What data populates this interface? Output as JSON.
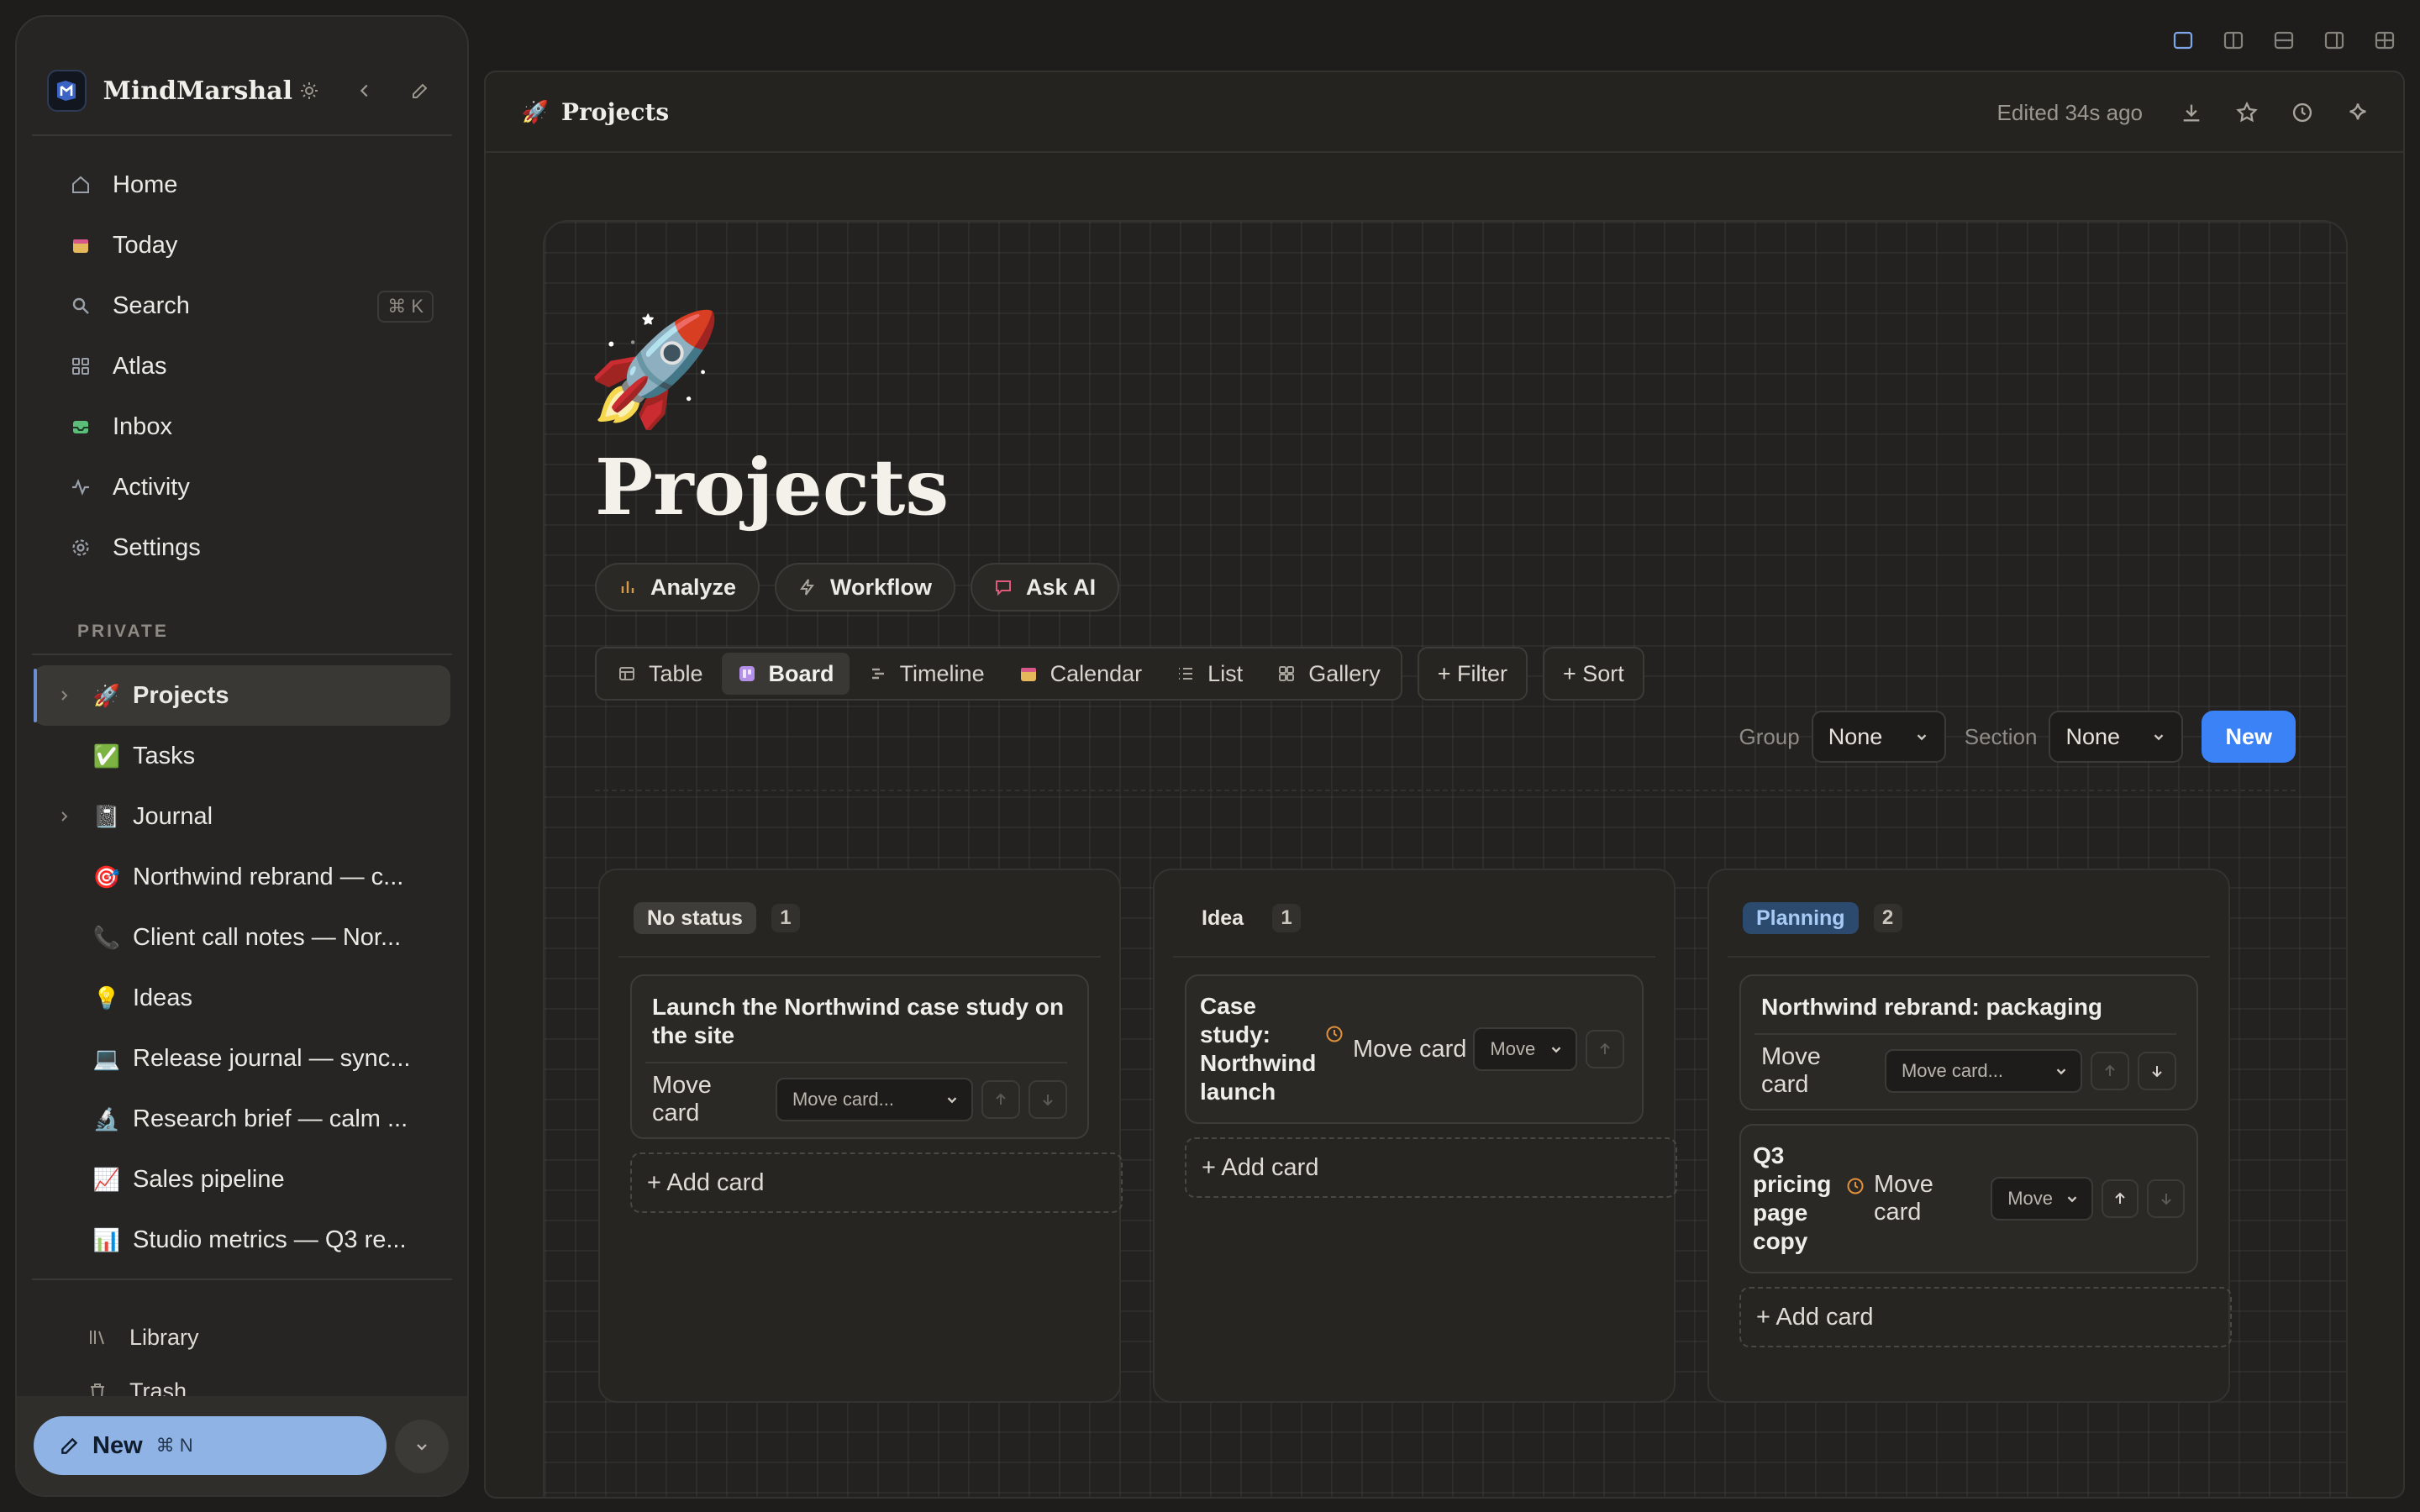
{
  "sidebar": {
    "brand": "MindMarshal",
    "nav": [
      {
        "label": "Home",
        "icon": "home-icon"
      },
      {
        "label": "Today",
        "icon": "calendar-icon"
      },
      {
        "label": "Search",
        "icon": "search-icon",
        "shortcut": "⌘ K"
      },
      {
        "label": "Atlas",
        "icon": "grid-icon"
      },
      {
        "label": "Inbox",
        "icon": "inbox-icon"
      },
      {
        "label": "Activity",
        "icon": "activity-icon"
      },
      {
        "label": "Settings",
        "icon": "gear-icon"
      }
    ],
    "section_label": "PRIVATE",
    "pages": [
      {
        "label": "Projects",
        "emoji": "🚀",
        "chevron": true,
        "active": true
      },
      {
        "label": "Tasks",
        "emoji": "✅"
      },
      {
        "label": "Journal",
        "emoji": "📓",
        "chevron": true
      },
      {
        "label": "Northwind rebrand — c...",
        "emoji": "🎯"
      },
      {
        "label": "Client call notes — Nor...",
        "emoji": "📞"
      },
      {
        "label": "Ideas",
        "emoji": "💡"
      },
      {
        "label": "Release journal — sync...",
        "emoji": "💻"
      },
      {
        "label": "Research brief — calm ...",
        "emoji": "🔬"
      },
      {
        "label": "Sales pipeline",
        "emoji": "📈"
      },
      {
        "label": "Studio metrics — Q3 re...",
        "emoji": "📊"
      }
    ],
    "bottom": [
      {
        "label": "Library",
        "icon": "library-icon"
      },
      {
        "label": "Trash",
        "icon": "trash-icon"
      }
    ],
    "new_button": {
      "label": "New",
      "shortcut": "⌘ N"
    }
  },
  "topbar": {
    "emoji": "🚀",
    "title": "Projects",
    "edited": "Edited 34s ago"
  },
  "page": {
    "emoji": "🚀",
    "title": "Projects",
    "actions": [
      {
        "label": "Analyze",
        "icon": "bar-chart-icon"
      },
      {
        "label": "Workflow",
        "icon": "bolt-icon"
      },
      {
        "label": "Ask AI",
        "icon": "chat-icon"
      }
    ],
    "views": [
      {
        "label": "Table",
        "icon": "table-icon"
      },
      {
        "label": "Board",
        "icon": "board-icon",
        "active": true
      },
      {
        "label": "Timeline",
        "icon": "timeline-icon"
      },
      {
        "label": "Calendar",
        "icon": "calendar-icon"
      },
      {
        "label": "List",
        "icon": "list-icon"
      },
      {
        "label": "Gallery",
        "icon": "gallery-icon"
      }
    ],
    "filter_label": "+ Filter",
    "sort_label": "+ Sort",
    "group_label": "Group",
    "group_value": "None",
    "section_label": "Section",
    "section_value": "None",
    "new_label": "New"
  },
  "board": {
    "move_label": "Move card",
    "add_label": "+ Add card",
    "columns": [
      {
        "name": "No status",
        "count": "1",
        "cards": [
          {
            "title": "Launch the Northwind case study on the site",
            "select": "Move card..."
          }
        ]
      },
      {
        "name": "Idea",
        "count": "1",
        "cards": [
          {
            "title": "Case study: Northwind launch",
            "select": "Move"
          }
        ]
      },
      {
        "name": "Planning",
        "count": "2",
        "cards": [
          {
            "title": "Northwind rebrand: packaging",
            "select": "Move card..."
          },
          {
            "title": "Q3 pricing page copy",
            "select": "Move"
          }
        ]
      }
    ]
  }
}
